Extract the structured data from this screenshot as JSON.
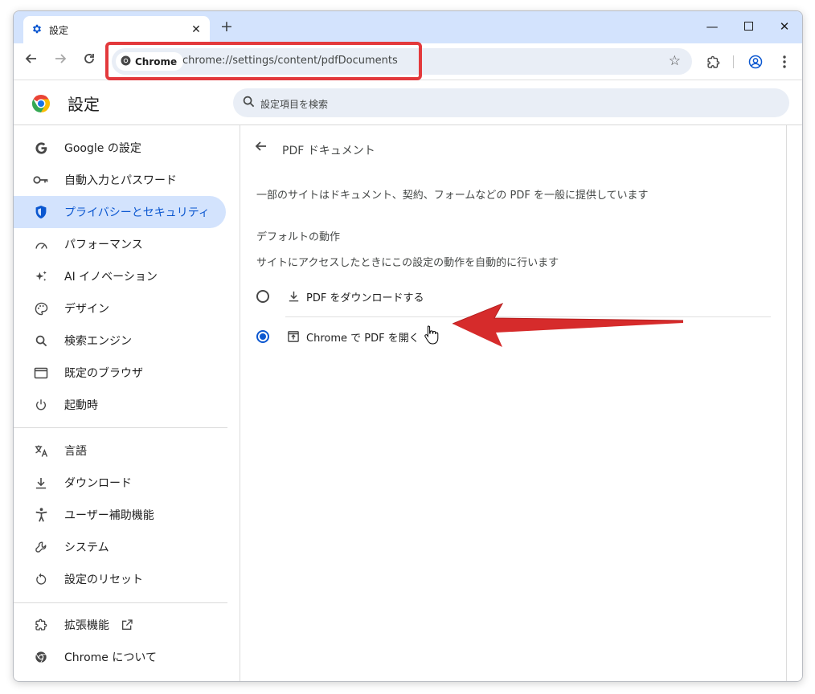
{
  "colors": {
    "accent": "#0b57d0",
    "tabstrip": "#d3e3fd",
    "highlight": "#e3393c"
  },
  "tab": {
    "title": "設定",
    "icon": "gear-icon"
  },
  "window_controls": {
    "minimize": "—",
    "maximize": "▢",
    "close": "✕"
  },
  "toolbar": {
    "chip_label": "Chrome",
    "url": "chrome://settings/content/pdfDocuments"
  },
  "settings": {
    "title": "設定",
    "search_placeholder": "設定項目を検索"
  },
  "sidebar": {
    "items": [
      {
        "label": "Google の設定",
        "icon": "google-g-icon"
      },
      {
        "label": "自動入力とパスワード",
        "icon": "key-icon"
      },
      {
        "label": "プライバシーとセキュリティ",
        "icon": "shield-icon",
        "active": true
      },
      {
        "label": "パフォーマンス",
        "icon": "speedometer-icon"
      },
      {
        "label": "AI イノベーション",
        "icon": "sparkle-icon"
      },
      {
        "label": "デザイン",
        "icon": "palette-icon"
      },
      {
        "label": "検索エンジン",
        "icon": "search-icon"
      },
      {
        "label": "既定のブラウザ",
        "icon": "browser-window-icon"
      },
      {
        "label": "起動時",
        "icon": "power-icon"
      },
      {
        "label": "言語",
        "icon": "translate-icon"
      },
      {
        "label": "ダウンロード",
        "icon": "download-icon"
      },
      {
        "label": "ユーザー補助機能",
        "icon": "accessibility-icon"
      },
      {
        "label": "システム",
        "icon": "wrench-icon"
      },
      {
        "label": "設定のリセット",
        "icon": "reset-icon"
      },
      {
        "label": "拡張機能",
        "icon": "puzzle-icon"
      },
      {
        "label": "Chrome について",
        "icon": "chrome-icon"
      }
    ]
  },
  "main": {
    "page_title": "PDF ドキュメント",
    "description": "一部のサイトはドキュメント、契約、フォームなどの PDF を一般に提供しています",
    "section_heading": "デフォルトの動作",
    "section_sub": "サイトにアクセスしたときにこの設定の動作を自動的に行います",
    "options": [
      {
        "label": "PDF をダウンロードする",
        "icon": "download-icon",
        "checked": false
      },
      {
        "label": "Chrome で PDF を開く",
        "icon": "open-in-icon",
        "checked": true
      }
    ]
  }
}
